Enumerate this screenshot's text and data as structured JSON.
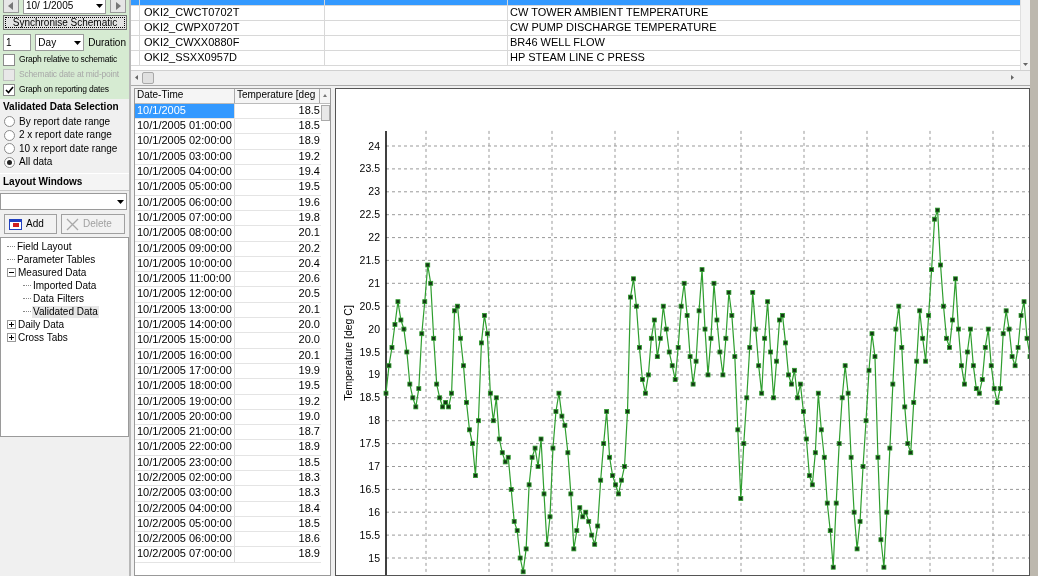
{
  "sidebar": {
    "date_picker": {
      "value": "10/ 1/2005"
    },
    "sync_button": "Synchronise Schematic",
    "duration": {
      "value": "1",
      "unit": "Day",
      "label": "Duration"
    },
    "options": [
      {
        "label": "Graph relative to schematic",
        "checked": false,
        "disabled": false
      },
      {
        "label": "Schematic date at mid-point",
        "checked": false,
        "disabled": true
      },
      {
        "label": "Graph on reporting dates",
        "checked": true,
        "disabled": false
      }
    ],
    "validated_selection": {
      "title": "Validated Data Selection",
      "options": [
        {
          "label": "By report date range",
          "selected": false
        },
        {
          "label": "2 x report date range",
          "selected": false
        },
        {
          "label": "10 x report date range",
          "selected": false
        },
        {
          "label": "All data",
          "selected": true
        }
      ]
    },
    "layout_windows": {
      "title": "Layout Windows",
      "buttons": [
        {
          "label": "Add",
          "disabled": false
        },
        {
          "label": "Delete",
          "disabled": true
        }
      ]
    },
    "tree": [
      {
        "label": "Field Layout",
        "selected": false
      },
      {
        "label": "Parameter Tables",
        "selected": false
      },
      {
        "label": "Measured Data",
        "selected": false,
        "expanded": true,
        "children": [
          {
            "label": "Imported Data",
            "selected": false
          },
          {
            "label": "Data Filters",
            "selected": false
          },
          {
            "label": "Validated Data",
            "selected": true
          }
        ]
      },
      {
        "label": "Daily Data",
        "selected": false,
        "expanded": false
      },
      {
        "label": "Cross Tabs",
        "selected": false,
        "expanded": false
      }
    ]
  },
  "parameters": {
    "rows": [
      {
        "selected": true
      },
      {
        "tag": "OKI2_CWCT0702T",
        "description": "CW TOWER AMBIENT TEMPERATURE",
        "selected": false
      },
      {
        "tag": "OKI2_CWPX0720T",
        "description": "CW PUMP DISCHARGE TEMPERATURE",
        "selected": false
      },
      {
        "tag": "OKI2_CWXX0880F",
        "description": "BR46 WELL FLOW",
        "selected": false
      },
      {
        "tag": "OKI2_SSXX0957D",
        "description": "HP STEAM LINE C PRESS",
        "selected": false
      }
    ]
  },
  "data_table": {
    "columns": [
      "Date-Time",
      "Temperature [deg"
    ],
    "rows": [
      {
        "time": "10/1/2005",
        "value": "18.5",
        "selected": true
      },
      {
        "time": "10/1/2005 01:00:00",
        "value": "18.5",
        "selected": false
      },
      {
        "time": "10/1/2005 02:00:00",
        "value": "18.9",
        "selected": false
      },
      {
        "time": "10/1/2005 03:00:00",
        "value": "19.2",
        "selected": false
      },
      {
        "time": "10/1/2005 04:00:00",
        "value": "19.4",
        "selected": false
      },
      {
        "time": "10/1/2005 05:00:00",
        "value": "19.5",
        "selected": false
      },
      {
        "time": "10/1/2005 06:00:00",
        "value": "19.6",
        "selected": false
      },
      {
        "time": "10/1/2005 07:00:00",
        "value": "19.8",
        "selected": false
      },
      {
        "time": "10/1/2005 08:00:00",
        "value": "20.1",
        "selected": false
      },
      {
        "time": "10/1/2005 09:00:00",
        "value": "20.2",
        "selected": false
      },
      {
        "time": "10/1/2005 10:00:00",
        "value": "20.4",
        "selected": false
      },
      {
        "time": "10/1/2005 11:00:00",
        "value": "20.6",
        "selected": false
      },
      {
        "time": "10/1/2005 12:00:00",
        "value": "20.5",
        "selected": false
      },
      {
        "time": "10/1/2005 13:00:00",
        "value": "20.1",
        "selected": false
      },
      {
        "time": "10/1/2005 14:00:00",
        "value": "20.0",
        "selected": false
      },
      {
        "time": "10/1/2005 15:00:00",
        "value": "20.0",
        "selected": false
      },
      {
        "time": "10/1/2005 16:00:00",
        "value": "20.1",
        "selected": false
      },
      {
        "time": "10/1/2005 17:00:00",
        "value": "19.9",
        "selected": false
      },
      {
        "time": "10/1/2005 18:00:00",
        "value": "19.5",
        "selected": false
      },
      {
        "time": "10/1/2005 19:00:00",
        "value": "19.2",
        "selected": false
      },
      {
        "time": "10/1/2005 20:00:00",
        "value": "19.0",
        "selected": false
      },
      {
        "time": "10/1/2005 21:00:00",
        "value": "18.7",
        "selected": false
      },
      {
        "time": "10/1/2005 22:00:00",
        "value": "18.9",
        "selected": false
      },
      {
        "time": "10/1/2005 23:00:00",
        "value": "18.5",
        "selected": false
      },
      {
        "time": "10/2/2005 02:00:00",
        "value": "18.3",
        "selected": false
      },
      {
        "time": "10/2/2005 03:00:00",
        "value": "18.3",
        "selected": false
      },
      {
        "time": "10/2/2005 04:00:00",
        "value": "18.4",
        "selected": false
      },
      {
        "time": "10/2/2005 05:00:00",
        "value": "18.5",
        "selected": false
      },
      {
        "time": "10/2/2005 06:00:00",
        "value": "18.6",
        "selected": false
      },
      {
        "time": "10/2/2005 07:00:00",
        "value": "18.9",
        "selected": false
      }
    ]
  },
  "chart": {
    "chart_data": {
      "type": "line",
      "ylabel": "Temperature [deg C]",
      "ylim": [
        14.61,
        24.33
      ],
      "grid": true,
      "yticks": [
        15,
        15.5,
        16,
        16.5,
        17,
        17.5,
        18,
        18.5,
        19,
        19.5,
        20,
        20.5,
        21,
        21.5,
        22,
        22.5,
        23,
        23.5,
        24
      ],
      "series": [
        {
          "color": "#2e9e2e",
          "marker": "square",
          "values": [
            18.6,
            19.2,
            19.6,
            20.1,
            20.6,
            20.2,
            20.0,
            19.5,
            18.8,
            18.5,
            18.3,
            18.7,
            19.9,
            20.6,
            21.4,
            21.0,
            19.8,
            18.8,
            18.5,
            18.3,
            18.4,
            18.3,
            18.6,
            20.4,
            20.5,
            19.8,
            19.2,
            18.4,
            17.8,
            17.5,
            16.8,
            18.0,
            19.7,
            20.3,
            19.9,
            18.6,
            18.0,
            18.5,
            17.6,
            17.3,
            17.1,
            17.2,
            16.5,
            15.8,
            15.6,
            15.0,
            14.7,
            15.2,
            16.6,
            17.2,
            17.4,
            17.0,
            17.6,
            16.4,
            15.3,
            15.9,
            17.4,
            18.2,
            18.6,
            18.1,
            17.9,
            17.3,
            16.4,
            15.2,
            15.6,
            16.1,
            15.9,
            16.0,
            15.8,
            15.5,
            15.3,
            15.7,
            16.7,
            17.5,
            18.2,
            17.2,
            16.8,
            16.6,
            16.4,
            16.7,
            17.0,
            18.2,
            20.7,
            21.1,
            20.5,
            19.6,
            18.9,
            18.6,
            19.0,
            19.8,
            20.2,
            19.4,
            19.8,
            20.5,
            20.0,
            19.5,
            19.2,
            18.9,
            19.6,
            20.5,
            21.0,
            20.3,
            19.4,
            18.8,
            19.3,
            20.4,
            21.3,
            20.0,
            19.0,
            19.8,
            21.0,
            20.2,
            19.5,
            19.0,
            19.8,
            20.8,
            20.3,
            19.4,
            17.8,
            16.3,
            17.5,
            18.5,
            19.6,
            20.8,
            20.0,
            19.2,
            18.6,
            19.8,
            20.6,
            19.5,
            18.5,
            19.3,
            20.2,
            20.3,
            19.7,
            19.0,
            18.8,
            19.1,
            18.5,
            18.8,
            18.2,
            17.6,
            16.8,
            16.6,
            17.3,
            18.6,
            17.8,
            17.2,
            16.2,
            15.6,
            14.8,
            16.2,
            17.5,
            18.5,
            19.2,
            18.6,
            17.2,
            16.0,
            15.2,
            15.8,
            17.0,
            18.0,
            19.1,
            19.9,
            19.4,
            17.2,
            15.4,
            14.8,
            16.0,
            17.4,
            18.8,
            20.0,
            20.5,
            19.6,
            18.3,
            17.5,
            17.3,
            18.4,
            19.3,
            20.4,
            19.8,
            19.3,
            20.3,
            21.3,
            22.4,
            22.6,
            21.4,
            20.5,
            19.8,
            19.6,
            20.2,
            21.1,
            20.0,
            19.2,
            18.8,
            19.5,
            20.0,
            19.2,
            18.7,
            18.6,
            18.9,
            19.6,
            20.0,
            19.2,
            18.7,
            18.4,
            18.7,
            19.9,
            20.4,
            20.0,
            19.4,
            19.2,
            19.6,
            20.3,
            20.6,
            19.8,
            19.4
          ]
        }
      ]
    }
  }
}
